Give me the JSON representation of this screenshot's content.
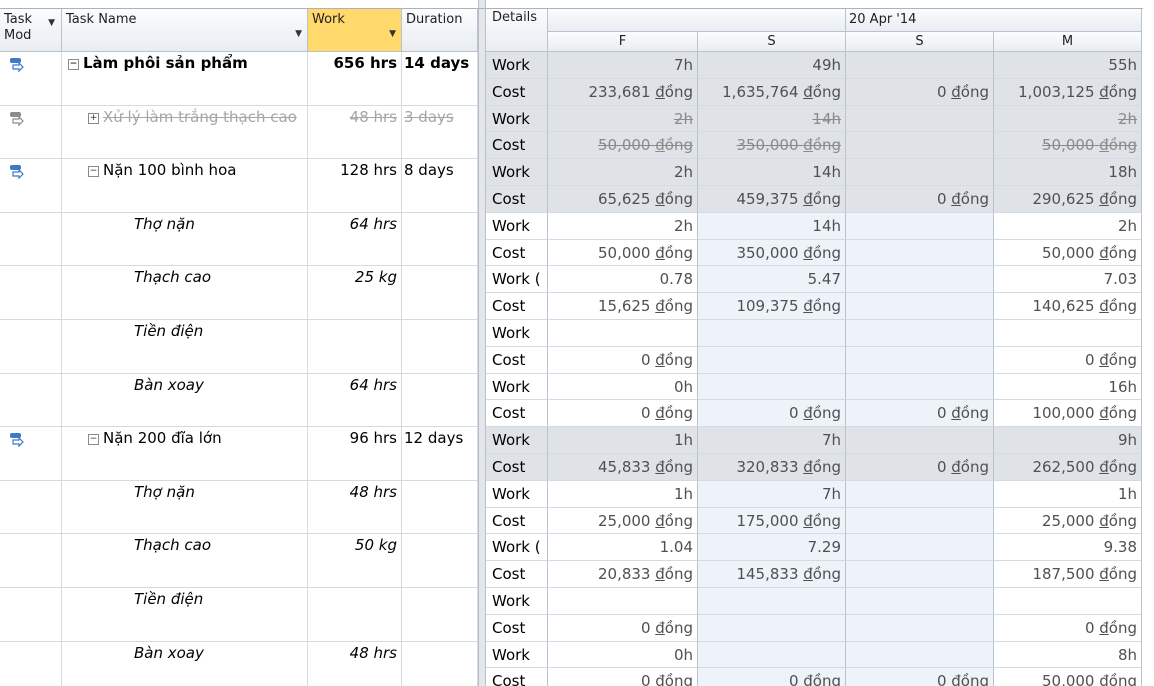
{
  "columns": {
    "task_mode": "Task Mod",
    "task_name": "Task Name",
    "work": "Work",
    "duration": "Duration",
    "details": "Details"
  },
  "timescale": {
    "week": "20 Apr '14",
    "days": [
      "F",
      "S",
      "S",
      "M"
    ]
  },
  "tasks": [
    {
      "name": "Làm phôi sản phẩm",
      "work": "656 hrs",
      "duration": "14 days",
      "work_row": {
        "label": "Work",
        "values": [
          "7h",
          "49h",
          "",
          "55h"
        ]
      },
      "cost_row": {
        "label": "Cost",
        "values": [
          "233,681 đồng",
          "1,635,764 đồng",
          "0 đồng",
          "1,003,125 đồng"
        ]
      }
    },
    {
      "name": "Xử lý làm trắng thạch cao",
      "work": "48 hrs",
      "duration": "3 days",
      "work_row": {
        "label": "Work",
        "values": [
          "2h",
          "14h",
          "",
          "2h"
        ]
      },
      "cost_row": {
        "label": "Cost",
        "values": [
          "50,000 đồng",
          "350,000 đồng",
          "",
          "50,000 đồng"
        ]
      }
    },
    {
      "name": "Nặn 100 bình hoa",
      "work": "128 hrs",
      "duration": "8 days",
      "work_row": {
        "label": "Work",
        "values": [
          "2h",
          "14h",
          "",
          "18h"
        ]
      },
      "cost_row": {
        "label": "Cost",
        "values": [
          "65,625 đồng",
          "459,375 đồng",
          "0 đồng",
          "290,625 đồng"
        ]
      }
    },
    {
      "name": "Thợ nặn",
      "work": "64 hrs",
      "duration": "",
      "work_row": {
        "label": "Work",
        "values": [
          "2h",
          "14h",
          "",
          "2h"
        ]
      },
      "cost_row": {
        "label": "Cost",
        "values": [
          "50,000 đồng",
          "350,000 đồng",
          "",
          "50,000 đồng"
        ]
      }
    },
    {
      "name": "Thạch cao",
      "work": "25 kg",
      "duration": "",
      "work_row": {
        "label": "Work (",
        "values": [
          "0.78",
          "5.47",
          "",
          "7.03"
        ]
      },
      "cost_row": {
        "label": "Cost",
        "values": [
          "15,625 đồng",
          "109,375 đồng",
          "",
          "140,625 đồng"
        ]
      }
    },
    {
      "name": "Tiền điện",
      "work": "",
      "duration": "",
      "work_row": {
        "label": "Work",
        "values": [
          "",
          "",
          "",
          ""
        ]
      },
      "cost_row": {
        "label": "Cost",
        "values": [
          "0 đồng",
          "",
          "",
          "0 đồng"
        ]
      }
    },
    {
      "name": "Bàn xoay",
      "work": "64 hrs",
      "duration": "",
      "work_row": {
        "label": "Work",
        "values": [
          "0h",
          "",
          "",
          "16h"
        ]
      },
      "cost_row": {
        "label": "Cost",
        "values": [
          "0 đồng",
          "0 đồng",
          "0 đồng",
          "100,000 đồng"
        ]
      }
    },
    {
      "name": "Nặn 200 đĩa lớn",
      "work": "96 hrs",
      "duration": "12 days",
      "work_row": {
        "label": "Work",
        "values": [
          "1h",
          "7h",
          "",
          "9h"
        ]
      },
      "cost_row": {
        "label": "Cost",
        "values": [
          "45,833 đồng",
          "320,833 đồng",
          "0 đồng",
          "262,500 đồng"
        ]
      }
    },
    {
      "name": "Thợ nặn",
      "work": "48 hrs",
      "duration": "",
      "work_row": {
        "label": "Work",
        "values": [
          "1h",
          "7h",
          "",
          "1h"
        ]
      },
      "cost_row": {
        "label": "Cost",
        "values": [
          "25,000 đồng",
          "175,000 đồng",
          "",
          "25,000 đồng"
        ]
      }
    },
    {
      "name": "Thạch cao",
      "work": "50 kg",
      "duration": "",
      "work_row": {
        "label": "Work (",
        "values": [
          "1.04",
          "7.29",
          "",
          "9.38"
        ]
      },
      "cost_row": {
        "label": "Cost",
        "values": [
          "20,833 đồng",
          "145,833 đồng",
          "",
          "187,500 đồng"
        ]
      }
    },
    {
      "name": "Tiền điện",
      "work": "",
      "duration": "",
      "work_row": {
        "label": "Work",
        "values": [
          "",
          "",
          "",
          ""
        ]
      },
      "cost_row": {
        "label": "Cost",
        "values": [
          "0 đồng",
          "",
          "",
          "0 đồng"
        ]
      }
    },
    {
      "name": "Bàn xoay",
      "work": "48 hrs",
      "duration": "",
      "work_row": {
        "label": "Work",
        "values": [
          "0h",
          "",
          "",
          "8h"
        ]
      },
      "cost_row": {
        "label": "Cost",
        "values": [
          "0 đồng",
          "0 đồng",
          "0 đồng",
          "50,000 đồng"
        ]
      }
    }
  ]
}
